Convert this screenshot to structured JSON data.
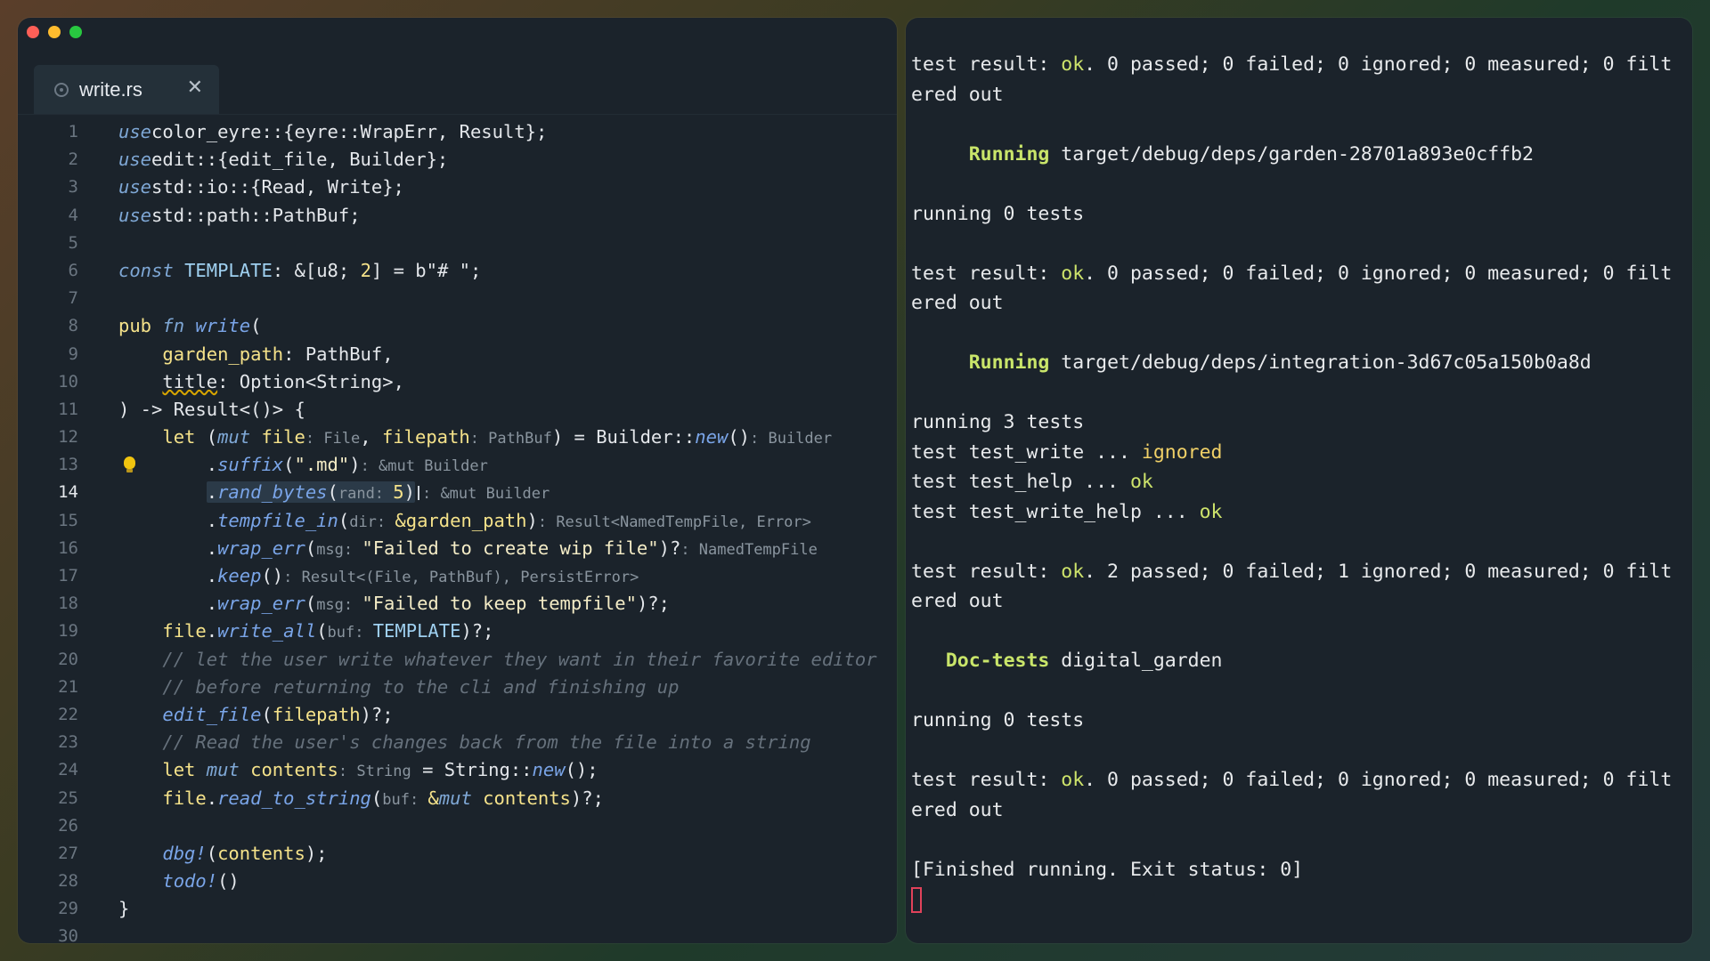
{
  "editor": {
    "window_controls": [
      "close",
      "minimize",
      "maximize"
    ],
    "tab": {
      "label": "write.rs",
      "icon": "rust-file-icon",
      "close_icon": "✕"
    },
    "current_line": 14,
    "lines": [
      {
        "n": "1",
        "t": [
          [
            "k",
            "use"
          ],
          [
            "",
            "color_eyre::{eyre::WrapErr, Result};"
          ]
        ]
      },
      {
        "n": "2",
        "t": [
          [
            "k",
            "use"
          ],
          [
            "",
            "edit::{edit_file, Builder};"
          ]
        ]
      },
      {
        "n": "3",
        "t": [
          [
            "k",
            "use"
          ],
          [
            "",
            "std::io::{Read, Write};"
          ]
        ]
      },
      {
        "n": "4",
        "t": [
          [
            "k",
            "use"
          ],
          [
            "",
            "std::path::PathBuf;"
          ]
        ]
      },
      {
        "n": "5",
        "t": []
      },
      {
        "n": "6",
        "t": [
          [
            "k",
            "const"
          ],
          [
            "",
            " "
          ],
          [
            "cy",
            "TEMPLATE"
          ],
          [
            "",
            ": &["
          ],
          [
            "",
            "u8"
          ],
          [
            "",
            "; "
          ],
          [
            "y",
            "2"
          ],
          [
            "",
            "] = b\"# \";"
          ]
        ]
      },
      {
        "n": "7",
        "t": []
      },
      {
        "n": "8",
        "t": [
          [
            "y",
            "pub "
          ],
          [
            "k",
            "fn"
          ],
          [
            "",
            " "
          ],
          [
            "fn",
            "write"
          ],
          [
            "",
            "("
          ]
        ]
      },
      {
        "n": "9",
        "t": [
          [
            "",
            "    "
          ],
          [
            "y",
            "garden_path"
          ],
          [
            "",
            ": PathBuf,"
          ]
        ]
      },
      {
        "n": "10",
        "t": [
          [
            "",
            "    "
          ],
          [
            "warn",
            "title"
          ],
          [
            "",
            ": Option<String>,"
          ]
        ]
      },
      {
        "n": "11",
        "t": [
          [
            "",
            ") -> Result<()> {"
          ]
        ]
      },
      {
        "n": "12",
        "t": [
          [
            "",
            "    "
          ],
          [
            "y",
            "let"
          ],
          [
            "",
            " ("
          ],
          [
            "k",
            "mut"
          ],
          [
            "",
            " "
          ],
          [
            "y",
            "file"
          ],
          [
            "h",
            ": File"
          ],
          [
            "",
            ", "
          ],
          [
            "y",
            "filepath"
          ],
          [
            "h",
            ": PathBuf"
          ],
          [
            "",
            ") = Builder::"
          ],
          [
            "fn",
            "new"
          ],
          [
            "",
            "()"
          ],
          [
            "h",
            ": Builder"
          ]
        ]
      },
      {
        "n": "13",
        "t": [
          [
            "",
            "        ."
          ],
          [
            "fn",
            "suffix"
          ],
          [
            "",
            "("
          ],
          [
            "s",
            "\".md\""
          ],
          [
            "",
            ")"
          ],
          [
            "h",
            ": &mut Builder"
          ]
        ],
        "bulb": true
      },
      {
        "n": "14",
        "t": [
          [
            "",
            "        "
          ],
          [
            "hlstart",
            ""
          ],
          [
            "",
            "."
          ],
          [
            "fn",
            "rand_bytes"
          ],
          [
            "",
            "("
          ],
          [
            "h",
            "rand: "
          ],
          [
            "y",
            "5"
          ],
          [
            "",
            ")"
          ],
          [
            "hlend",
            ""
          ],
          [
            "ibeam",
            ""
          ],
          [
            "h",
            ": &mut Builder"
          ]
        ]
      },
      {
        "n": "15",
        "t": [
          [
            "",
            "        ."
          ],
          [
            "fn",
            "tempfile_in"
          ],
          [
            "",
            "("
          ],
          [
            "h",
            "dir: "
          ],
          [
            "y",
            "&garden_path"
          ],
          [
            "",
            ")"
          ],
          [
            "h",
            ": Result<NamedTempFile, Error>"
          ]
        ]
      },
      {
        "n": "16",
        "t": [
          [
            "",
            "        ."
          ],
          [
            "fn",
            "wrap_err"
          ],
          [
            "",
            "("
          ],
          [
            "h",
            "msg: "
          ],
          [
            "s",
            "\"Failed to create wip file\""
          ],
          [
            "",
            ")?"
          ],
          [
            "h",
            ": NamedTempFile"
          ]
        ]
      },
      {
        "n": "17",
        "t": [
          [
            "",
            "        ."
          ],
          [
            "fn",
            "keep"
          ],
          [
            "",
            "()"
          ],
          [
            "h",
            ": Result<(File, PathBuf), PersistError>"
          ]
        ]
      },
      {
        "n": "18",
        "t": [
          [
            "",
            "        ."
          ],
          [
            "fn",
            "wrap_err"
          ],
          [
            "",
            "("
          ],
          [
            "h",
            "msg: "
          ],
          [
            "s",
            "\"Failed to keep tempfile\""
          ],
          [
            "",
            ")?;"
          ]
        ]
      },
      {
        "n": "19",
        "t": [
          [
            "",
            "    "
          ],
          [
            "y",
            "file"
          ],
          [
            "",
            "."
          ],
          [
            "fn",
            "write_all"
          ],
          [
            "",
            "("
          ],
          [
            "h",
            "buf: "
          ],
          [
            "cy",
            "TEMPLATE"
          ],
          [
            "",
            ")?;"
          ]
        ]
      },
      {
        "n": "20",
        "t": [
          [
            "",
            "    "
          ],
          [
            "c",
            "// let the user write whatever they want in their favorite editor"
          ]
        ]
      },
      {
        "n": "21",
        "t": [
          [
            "",
            "    "
          ],
          [
            "c",
            "// before returning to the cli and finishing up"
          ]
        ]
      },
      {
        "n": "22",
        "t": [
          [
            "",
            "    "
          ],
          [
            "fn",
            "edit_file"
          ],
          [
            "",
            "("
          ],
          [
            "y",
            "filepath"
          ],
          [
            "",
            ")?;"
          ]
        ]
      },
      {
        "n": "23",
        "t": [
          [
            "",
            "    "
          ],
          [
            "c",
            "// Read the user's changes back from the file into a string"
          ]
        ]
      },
      {
        "n": "24",
        "t": [
          [
            "",
            "    "
          ],
          [
            "y",
            "let "
          ],
          [
            "k",
            "mut"
          ],
          [
            "",
            " "
          ],
          [
            "y",
            "contents"
          ],
          [
            "h",
            ": String"
          ],
          [
            "",
            " = String::"
          ],
          [
            "fn",
            "new"
          ],
          [
            "",
            "();"
          ]
        ]
      },
      {
        "n": "25",
        "t": [
          [
            "",
            "    "
          ],
          [
            "y",
            "file"
          ],
          [
            "",
            "."
          ],
          [
            "fn",
            "read_to_string"
          ],
          [
            "",
            "("
          ],
          [
            "h",
            "buf: "
          ],
          [
            "y",
            "&"
          ],
          [
            "k",
            "mut"
          ],
          [
            "",
            " "
          ],
          [
            "y",
            "contents"
          ],
          [
            "",
            ")?;"
          ]
        ]
      },
      {
        "n": "26",
        "t": []
      },
      {
        "n": "27",
        "t": [
          [
            "",
            "    "
          ],
          [
            "fn",
            "dbg!"
          ],
          [
            "",
            "("
          ],
          [
            "y",
            "contents"
          ],
          [
            "",
            ");"
          ]
        ]
      },
      {
        "n": "28",
        "t": [
          [
            "",
            "    "
          ],
          [
            "fn",
            "todo!"
          ],
          [
            "",
            "()"
          ]
        ]
      },
      {
        "n": "29",
        "t": [
          [
            "",
            "}"
          ]
        ]
      },
      {
        "n": "30",
        "t": []
      }
    ]
  },
  "terminal": {
    "lines": [
      [
        [
          "",
          "test result: "
        ],
        [
          "ok",
          "ok"
        ],
        [
          "",
          ". 0 passed; 0 failed; 0 ignored; 0 measured; 0 filt"
        ]
      ],
      [
        [
          "",
          "ered out"
        ]
      ],
      [],
      [
        [
          "",
          "     "
        ],
        [
          "grn",
          "Running"
        ],
        [
          "",
          " target/debug/deps/garden-28701a893e0cffb2"
        ]
      ],
      [],
      [
        [
          "",
          "running 0 tests"
        ]
      ],
      [],
      [
        [
          "",
          "test result: "
        ],
        [
          "ok",
          "ok"
        ],
        [
          "",
          ". 0 passed; 0 failed; 0 ignored; 0 measured; 0 filt"
        ]
      ],
      [
        [
          "",
          "ered out"
        ]
      ],
      [],
      [
        [
          "",
          "     "
        ],
        [
          "grn",
          "Running"
        ],
        [
          "",
          " target/debug/deps/integration-3d67c05a150b0a8d"
        ]
      ],
      [],
      [
        [
          "",
          "running 3 tests"
        ]
      ],
      [
        [
          "",
          "test test_write ... "
        ],
        [
          "ign",
          "ignored"
        ]
      ],
      [
        [
          "",
          "test test_help ... "
        ],
        [
          "ok",
          "ok"
        ]
      ],
      [
        [
          "",
          "test test_write_help ... "
        ],
        [
          "ok",
          "ok"
        ]
      ],
      [],
      [
        [
          "",
          "test result: "
        ],
        [
          "ok",
          "ok"
        ],
        [
          "",
          ". 2 passed; 0 failed; 1 ignored; 0 measured; 0 filt"
        ]
      ],
      [
        [
          "",
          "ered out"
        ]
      ],
      [],
      [
        [
          "",
          "   "
        ],
        [
          "grn",
          "Doc-tests"
        ],
        [
          "",
          " digital_garden"
        ]
      ],
      [],
      [
        [
          "",
          "running 0 tests"
        ]
      ],
      [],
      [
        [
          "",
          "test result: "
        ],
        [
          "ok",
          "ok"
        ],
        [
          "",
          ". 0 passed; 0 failed; 0 ignored; 0 measured; 0 filt"
        ]
      ],
      [
        [
          "",
          "ered out"
        ]
      ],
      [],
      [
        [
          "",
          "[Finished running. Exit status: 0]"
        ]
      ],
      [
        [
          "cursor",
          ""
        ]
      ]
    ]
  }
}
